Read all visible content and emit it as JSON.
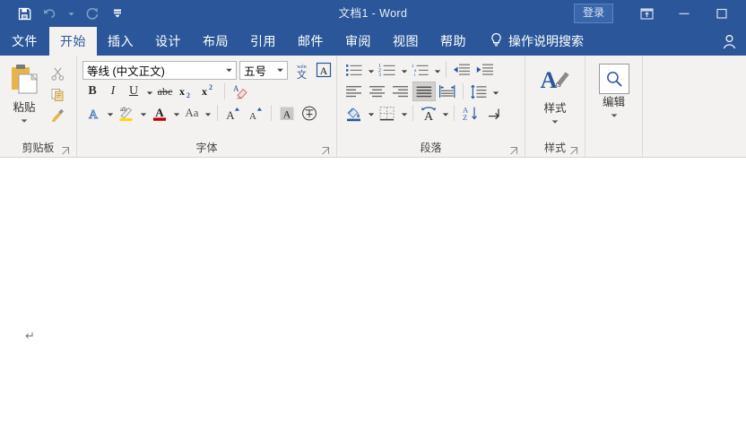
{
  "window": {
    "title": "文档1  -  Word",
    "quick_access": [
      {
        "name": "save-icon",
        "label": "保存"
      },
      {
        "name": "undo-icon",
        "label": "撤消"
      },
      {
        "name": "undo-dropdown-icon",
        "label": "撤消下拉"
      },
      {
        "name": "redo-icon",
        "label": "重复"
      },
      {
        "name": "customize-qat-icon",
        "label": "自定义快速访问工具栏"
      }
    ],
    "signin_label": "登录",
    "controls": [
      {
        "name": "ribbon-display-options-icon",
        "label": "功能区显示选项"
      },
      {
        "name": "minimize-icon",
        "label": "最小化"
      },
      {
        "name": "maximize-icon",
        "label": "最大化"
      }
    ]
  },
  "tabs": [
    {
      "label": "文件",
      "active": false
    },
    {
      "label": "开始",
      "active": true
    },
    {
      "label": "插入",
      "active": false
    },
    {
      "label": "设计",
      "active": false
    },
    {
      "label": "布局",
      "active": false
    },
    {
      "label": "引用",
      "active": false
    },
    {
      "label": "邮件",
      "active": false
    },
    {
      "label": "审阅",
      "active": false
    },
    {
      "label": "视图",
      "active": false
    },
    {
      "label": "帮助",
      "active": false
    }
  ],
  "tellme": {
    "label": "操作说明搜索",
    "icon": "lightbulb-icon"
  },
  "account": {
    "icon": "account-person-icon"
  },
  "ribbon": {
    "clipboard": {
      "label": "剪贴板",
      "paste_label": "粘贴",
      "buttons": [
        {
          "name": "cut-button",
          "label": "剪切"
        },
        {
          "name": "copy-button",
          "label": "复制"
        },
        {
          "name": "format-painter-button",
          "label": "格式刷"
        }
      ]
    },
    "font": {
      "label": "字体",
      "font_name": "等线 (中文正文)",
      "font_size": "五号",
      "buttons": [
        {
          "name": "phonetic-guide-button",
          "label": "拼音指南"
        },
        {
          "name": "character-border-button",
          "label": "字符边框"
        },
        {
          "name": "bold-button",
          "label": "B"
        },
        {
          "name": "italic-button",
          "label": "I"
        },
        {
          "name": "underline-button",
          "label": "U"
        },
        {
          "name": "strikethrough-button",
          "label": "abc"
        },
        {
          "name": "subscript-button",
          "label": "x₂"
        },
        {
          "name": "superscript-button",
          "label": "x²"
        },
        {
          "name": "clear-formatting-button",
          "label": "清除所有格式"
        },
        {
          "name": "text-effects-button",
          "label": "文本效果和版式"
        },
        {
          "name": "text-highlight-button",
          "label": "文本突出显示颜色"
        },
        {
          "name": "font-color-button",
          "label": "字体颜色"
        },
        {
          "name": "change-case-button",
          "label": "Aa"
        },
        {
          "name": "grow-font-button",
          "label": "增大字号"
        },
        {
          "name": "shrink-font-button",
          "label": "减小字号"
        },
        {
          "name": "character-shading-button",
          "label": "字符底纹"
        },
        {
          "name": "enclose-character-button",
          "label": "带圈字符"
        }
      ]
    },
    "paragraph": {
      "label": "段落",
      "buttons": [
        {
          "name": "bullets-button",
          "label": "项目符号"
        },
        {
          "name": "numbering-button",
          "label": "编号"
        },
        {
          "name": "multilevel-list-button",
          "label": "多级列表"
        },
        {
          "name": "decrease-indent-button",
          "label": "减少缩进量"
        },
        {
          "name": "increase-indent-button",
          "label": "增加缩进量"
        },
        {
          "name": "align-left-button",
          "label": "左对齐"
        },
        {
          "name": "align-center-button",
          "label": "居中"
        },
        {
          "name": "align-right-button",
          "label": "右对齐"
        },
        {
          "name": "justify-button",
          "label": "两端对齐",
          "active": true
        },
        {
          "name": "distribute-button",
          "label": "分散对齐"
        },
        {
          "name": "line-spacing-button",
          "label": "行和段落间距"
        },
        {
          "name": "shading-button",
          "label": "底纹"
        },
        {
          "name": "borders-button",
          "label": "边框"
        },
        {
          "name": "asian-layout-button",
          "label": "中文版式"
        },
        {
          "name": "sort-button",
          "label": "排序"
        },
        {
          "name": "show-marks-button",
          "label": "显示编辑标记"
        }
      ]
    },
    "styles": {
      "label": "样式",
      "button_label": "样式"
    },
    "editing": {
      "button_label": "编辑"
    }
  },
  "document": {
    "paragraph_mark": "↵"
  },
  "colors": {
    "word_blue": "#2b579a",
    "ribbon_bg": "#f3f2f1",
    "accent_icon_blue": "#2b579a",
    "highlight_yellow": "#ffd900",
    "font_color_red": "#c00000",
    "paste_gold": "#e8b34a"
  }
}
